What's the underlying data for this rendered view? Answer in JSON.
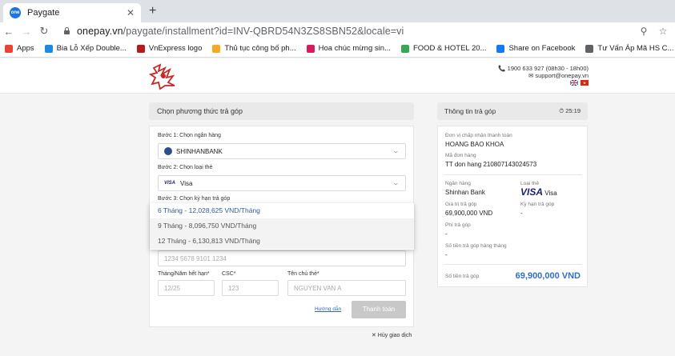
{
  "browser": {
    "tab_title": "Paygate",
    "tab_favicon": "onepay",
    "url_host": "onepay.vn",
    "url_path": "/paygate/installment?id=INV-QBRD54N3ZS8SBN52&locale=vi",
    "new_tab": "+",
    "close_tab": "✕"
  },
  "bookmarks": [
    {
      "label": "Apps",
      "icon": "apps-grid-icon",
      "color": "#ea4335"
    },
    {
      "label": "Bia Lỗ Xếp Double...",
      "icon": "bookmark-icon",
      "color": "#1e88e5"
    },
    {
      "label": "VnExpress logo",
      "icon": "vnexpress-icon",
      "color": "#b71c1c"
    },
    {
      "label": "Thủ tục công bố ph...",
      "icon": "td-icon",
      "color": "#f9a825"
    },
    {
      "label": "Hoa chúc mừng sin...",
      "icon": "flower-icon",
      "color": "#d81b60"
    },
    {
      "label": "FOOD & HOTEL 20...",
      "icon": "drive-icon",
      "color": "#34a853"
    },
    {
      "label": "Share on Facebook",
      "icon": "facebook-icon",
      "color": "#1877f2"
    },
    {
      "label": "Tư Vấn Áp Mã HS C...",
      "icon": "globe-icon",
      "color": "#5f6368"
    }
  ],
  "header": {
    "phone": "1900 633 927 (08h30 - 18h00)",
    "email": "support@onepay.vn"
  },
  "left": {
    "title": "Chọn phương thức trả góp",
    "step1_label": "Bước 1: Chọn ngân hàng",
    "bank": "SHINHANBANK",
    "step2_label": "Bước 2: Chọn loại thẻ",
    "card_type_badge": "VISA",
    "card_type": "Visa",
    "step3_label": "Bước 3: Chọn kỳ hạn trả góp",
    "terms": [
      "6 Tháng - 12,028,625 VND/Tháng",
      "9 Tháng - 8,096,750 VND/Tháng",
      "12 Tháng - 6,130,813 VND/Tháng"
    ],
    "card_number_placeholder": "1234 5678 9101 1234",
    "expiry_label": "Tháng/Năm hết hạn*",
    "expiry_placeholder": "12/25",
    "cvc_label": "CSC*",
    "cvc_placeholder": "123",
    "name_label": "Tên chủ thẻ*",
    "name_placeholder": "NGUYEN VAN A",
    "guide": "Hướng dẫn",
    "pay": "Thanh toán",
    "cancel": "✕ Hủy giao dịch"
  },
  "right": {
    "title": "Thông tin trả góp",
    "timer": "25:19",
    "merchant_label": "Đơn vị chấp nhận thanh toán",
    "merchant": "HOANG BAO KHOA",
    "order_label": "Mã đơn hàng",
    "order": "TT don hang 210807143024573",
    "bank_label": "Ngân hàng",
    "bank": "Shinhan Bank",
    "card_label": "Loại thẻ",
    "card_logo": "VISA",
    "card": "Visa",
    "amount_label": "Giá trị trả góp",
    "amount": "69,900,000 VND",
    "term_label": "Kỳ hạn trả góp",
    "term": "-",
    "fee_label": "Phí trả góp",
    "fee": "-",
    "monthly_label": "Số tiền trả góp hàng tháng",
    "monthly": "-",
    "total_label": "Số tiền trả góp",
    "total": "69,900,000 VND"
  }
}
